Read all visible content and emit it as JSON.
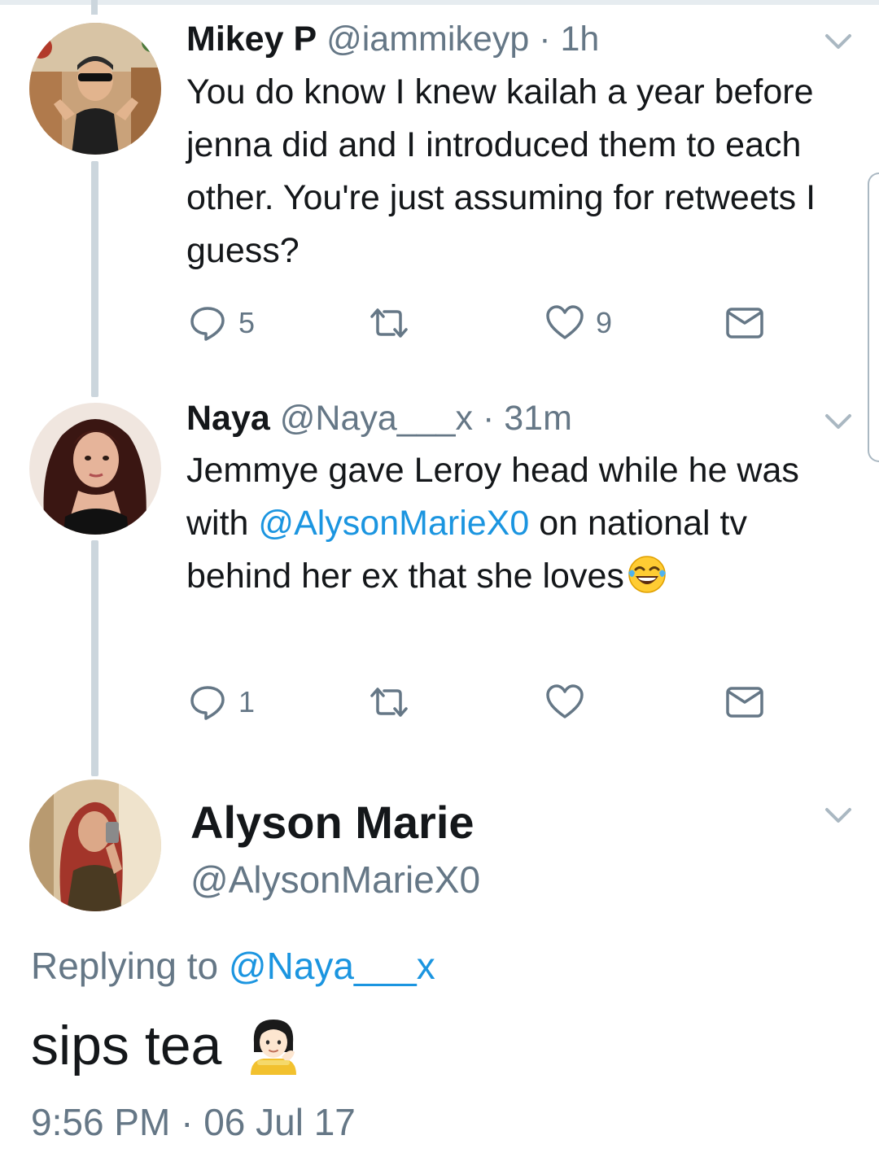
{
  "colors": {
    "link": "#1b95e0",
    "secondary_text": "#657786",
    "primary_text": "#14171a",
    "thread_line": "#ccd6dd"
  },
  "tweets": [
    {
      "name": "Mikey P",
      "handle": "@iammikeyp",
      "time": "· 1h",
      "text": "You do know I knew kailah a year before jenna did and I introduced them to each other. You're just assuming for retweets I guess?",
      "reply_count": "5",
      "retweet_count": "",
      "like_count": "9",
      "icons": [
        "reply-icon",
        "retweet-icon",
        "like-icon",
        "dm-icon",
        "chevron-down-icon"
      ]
    },
    {
      "name": "Naya",
      "handle": "@Naya___x",
      "time": "· 31m",
      "text_before": "Jemmye gave Leroy head while he was with ",
      "mention": "@AlysonMarieX0",
      "text_after": " on national tv behind her ex that she loves",
      "emoji": "face-with-tears-of-joy",
      "reply_count": "1",
      "retweet_count": "",
      "like_count": "",
      "icons": [
        "reply-icon",
        "retweet-icon",
        "like-icon",
        "dm-icon",
        "chevron-down-icon"
      ]
    }
  ],
  "main_tweet": {
    "name": "Alyson Marie",
    "handle": "@AlysonMarieX0",
    "replying_prefix": "Replying to ",
    "replying_to": "@Naya___x",
    "text": "sips tea",
    "emoji": "woman-tipping-hand",
    "timestamp": "9:56 PM · 06 Jul 17"
  }
}
